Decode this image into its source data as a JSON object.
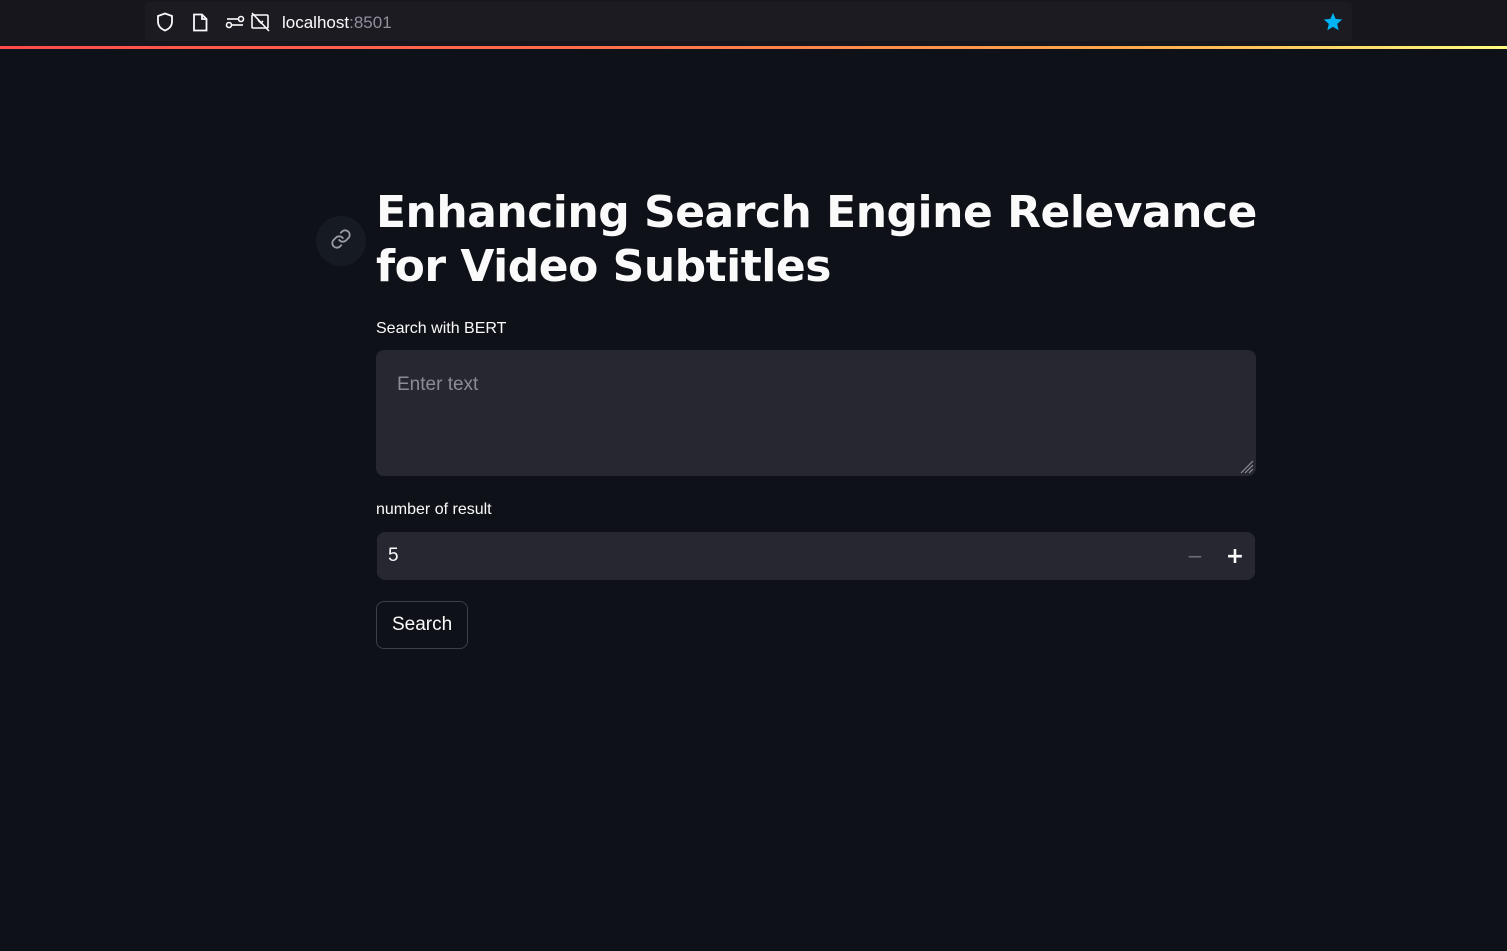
{
  "browser": {
    "url_host": "localhost",
    "url_port": ":8501",
    "icons": [
      "shield-icon",
      "page-icon",
      "permissions-icon",
      "camera-blocked-icon",
      "bookmark-star-icon"
    ],
    "accent_color": "#00b3f4"
  },
  "page": {
    "title": "Enhancing Search Engine Relevance for Video Subtitles",
    "anchor_icon": "link-icon"
  },
  "search_field": {
    "label": "Search with BERT",
    "placeholder": "Enter text",
    "value": ""
  },
  "result_count": {
    "label": "number of result",
    "value": "5",
    "decrement_symbol": "−",
    "increment_symbol": "+"
  },
  "search_button": {
    "label": "Search"
  },
  "colors": {
    "background": "#0e1117",
    "input_background": "#262730",
    "text": "#fafafa",
    "loading_bar_start": "#ff4b4b",
    "loading_bar_end": "#fffd80"
  }
}
